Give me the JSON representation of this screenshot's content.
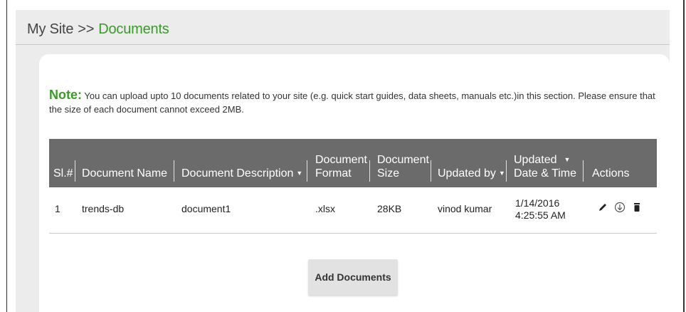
{
  "breadcrumb": {
    "root": "My Site",
    "separator": ">>",
    "current": "Documents"
  },
  "note": {
    "label": "Note:",
    "text": " You can upload upto 10 documents related to your site (e.g. quick start guides, data sheets, manuals etc.)in this section. Please ensure that the size of each document cannot exceed 2MB."
  },
  "table": {
    "headers": {
      "sl": "Sl.#",
      "name": "Document Name",
      "description": "Document Description",
      "format_line1": "Document",
      "format_line2": "Format",
      "size_line1": "Document",
      "size_line2": "Size",
      "updated_by": "Updated by",
      "updated_line1": "Updated",
      "updated_line2": "Date & Time",
      "actions": "Actions"
    },
    "rows": [
      {
        "sl": "1",
        "name": "trends-db",
        "description": "document1",
        "format": ".xlsx",
        "size": "28KB",
        "updated_by": "vinod kumar",
        "date": "1/14/2016",
        "time": "4:25:55 AM"
      }
    ]
  },
  "add_button": "Add Documents",
  "colors": {
    "accent_green": "#3a9a2a",
    "header_gray": "#6b6b6b"
  },
  "icons": {
    "edit": "pencil-icon",
    "download": "download-icon",
    "delete": "trash-icon",
    "sort": "sort-down-icon"
  }
}
